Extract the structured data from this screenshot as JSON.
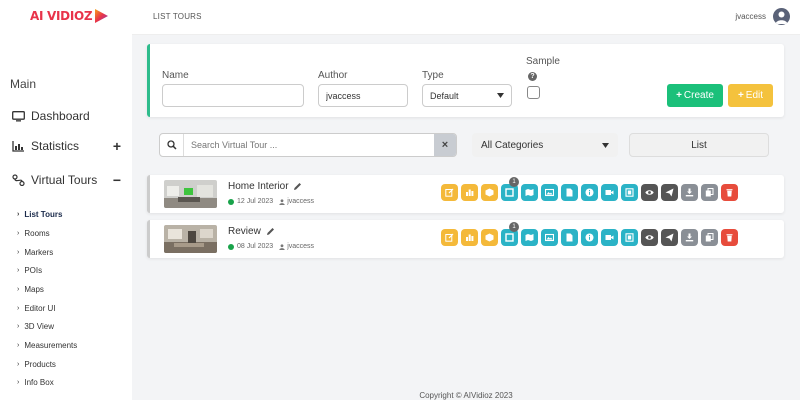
{
  "brand": {
    "logo_text": "AI VIDIOZ"
  },
  "topbar": {
    "title": "LIST TOURS",
    "user": "jvaccess"
  },
  "sidebar": {
    "section": "Main",
    "items": [
      {
        "label": "Dashboard",
        "icon": "monitor-icon"
      },
      {
        "label": "Statistics",
        "icon": "chart-icon",
        "toggle": "+"
      },
      {
        "label": "Virtual Tours",
        "icon": "route-icon",
        "toggle": "−"
      }
    ],
    "sub_items": [
      "List Tours",
      "Rooms",
      "Markers",
      "POIs",
      "Maps",
      "Editor UI",
      "3D View",
      "Measurements",
      "Products",
      "Info Box"
    ]
  },
  "filter": {
    "name_label": "Name",
    "name_value": "",
    "author_label": "Author",
    "author_value": "jvaccess",
    "type_label": "Type",
    "type_value": "Default",
    "sample_label": "Sample",
    "create_label": "Create",
    "edit_label": "Edit"
  },
  "search": {
    "placeholder": "Search Virtual Tour ...",
    "category": "All Categories",
    "view": "List"
  },
  "tours": [
    {
      "name": "Home Interior",
      "date": "12 Jul 2023",
      "author": "jvaccess",
      "badge": "1"
    },
    {
      "name": "Review",
      "date": "08 Jul 2023",
      "author": "jvaccess",
      "badge": "1"
    }
  ],
  "footer": {
    "copyright": "Copyright © AIVidioz 2023"
  }
}
